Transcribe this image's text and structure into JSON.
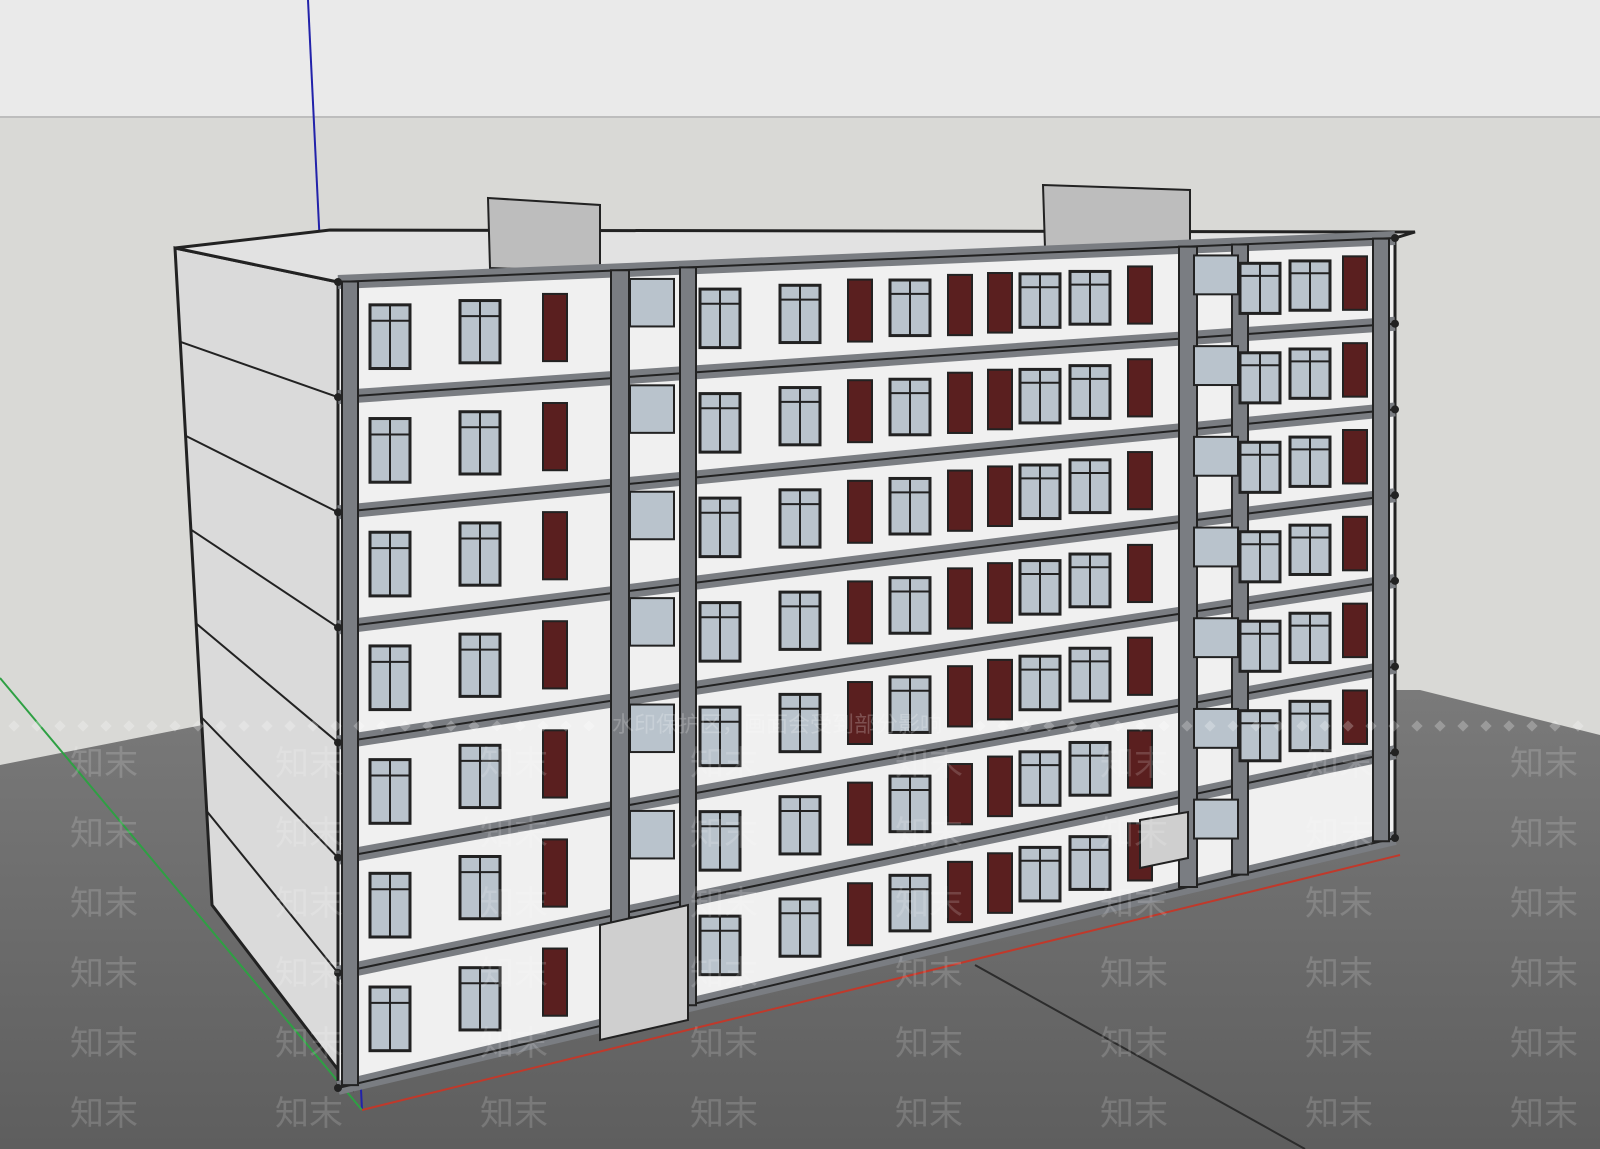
{
  "app": {
    "view": "3d-model-viewport",
    "scene": "six-storey-building-model"
  },
  "watermark": {
    "brand": "知末",
    "notice": "水印保护区，画面会受到部分影响"
  },
  "colors": {
    "sky": "#eaeaea",
    "background": "#d9d9d6",
    "ground": "#6f6f6f",
    "wall_light": "#f0f0f0",
    "wall_side": "#dadada",
    "frame": "#7a7d82",
    "edge": "#222222",
    "door": "#5a1f1f",
    "glass": "#b9c3cc",
    "axis_red": "#c0392b",
    "axis_green": "#2ea043",
    "axis_blue": "#2222aa"
  }
}
